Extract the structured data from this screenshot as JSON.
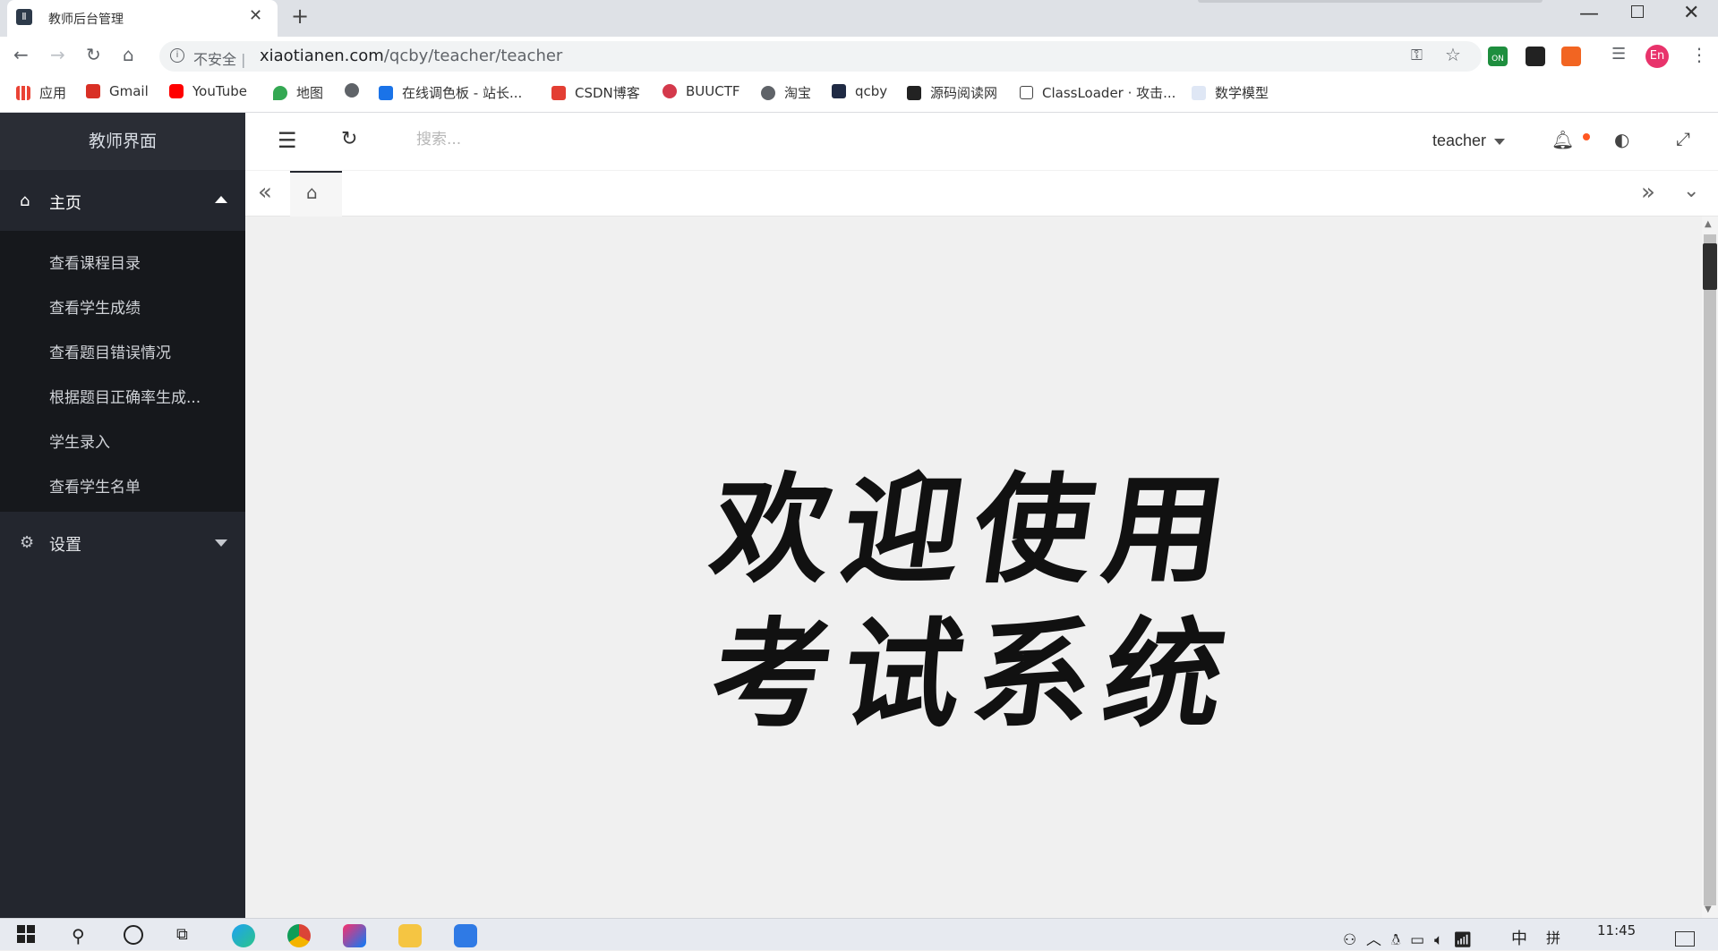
{
  "browser": {
    "tab_title": "教师后台管理",
    "url_security": "不安全",
    "url_host": "xiaotianen.com",
    "url_path": "/qcby/teacher/teacher",
    "profile_initials": "En",
    "ext_badge": "ON"
  },
  "bookmarks": [
    {
      "label": "应用",
      "icon": "apps-grid-icon",
      "color": "#ea4335"
    },
    {
      "label": "Gmail",
      "icon": "gmail-icon",
      "color": "#d93025"
    },
    {
      "label": "YouTube",
      "icon": "youtube-icon",
      "color": "#ff0000"
    },
    {
      "label": "地图",
      "icon": "maps-pin-icon",
      "color": "#34a853"
    },
    {
      "label": "",
      "icon": "globe-icon",
      "color": "#5f6368"
    },
    {
      "label": "在线调色板 - 站长...",
      "icon": "palette-icon",
      "color": "#1a73e8"
    },
    {
      "label": "CSDN博客",
      "icon": "csdn-icon",
      "color": "#e33e33"
    },
    {
      "label": "BUUCTF",
      "icon": "buuctf-icon",
      "color": "#d4394b"
    },
    {
      "label": "淘宝",
      "icon": "globe-icon",
      "color": "#5f6368"
    },
    {
      "label": "qcby",
      "icon": "qcby-icon",
      "color": "#1f2a44"
    },
    {
      "label": "源码阅读网",
      "icon": "source-icon",
      "color": "#222222"
    },
    {
      "label": "ClassLoader · 攻击...",
      "icon": "book-icon",
      "color": "#444444"
    },
    {
      "label": "数学模型",
      "icon": "page-icon",
      "color": "#dfe7f5"
    }
  ],
  "sidebar": {
    "title": "教师界面",
    "home_label": "主页",
    "items": [
      {
        "label": "查看课程目录"
      },
      {
        "label": "查看学生成绩"
      },
      {
        "label": "查看题目错误情况"
      },
      {
        "label": "根据题目正确率生成..."
      },
      {
        "label": "学生录入"
      },
      {
        "label": "查看学生名单"
      }
    ],
    "settings_label": "设置"
  },
  "header": {
    "search_placeholder": "搜索...",
    "user_name": "teacher"
  },
  "main": {
    "welcome_line1": "欢迎使用",
    "welcome_line2": "考试系统"
  },
  "taskbar": {
    "language": "中",
    "ime": "拼",
    "time": "11:45"
  }
}
